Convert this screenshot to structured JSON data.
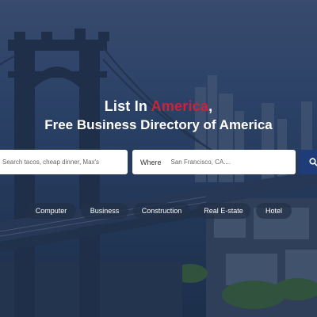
{
  "hero": {
    "title_prefix": "List In ",
    "title_accent": "America",
    "title_suffix": ",",
    "subtitle": "Free Business Directory of America",
    "accent_color": "#c8243a"
  },
  "search": {
    "what_placeholder": "Search tacos, cheap dinner, Max's",
    "where_label": "Where",
    "where_placeholder": "San Francisco, CA....",
    "button_icon": "search-icon"
  },
  "categories": [
    "Computer",
    "Business",
    "Construction",
    "Real E-state",
    "Hotel"
  ]
}
